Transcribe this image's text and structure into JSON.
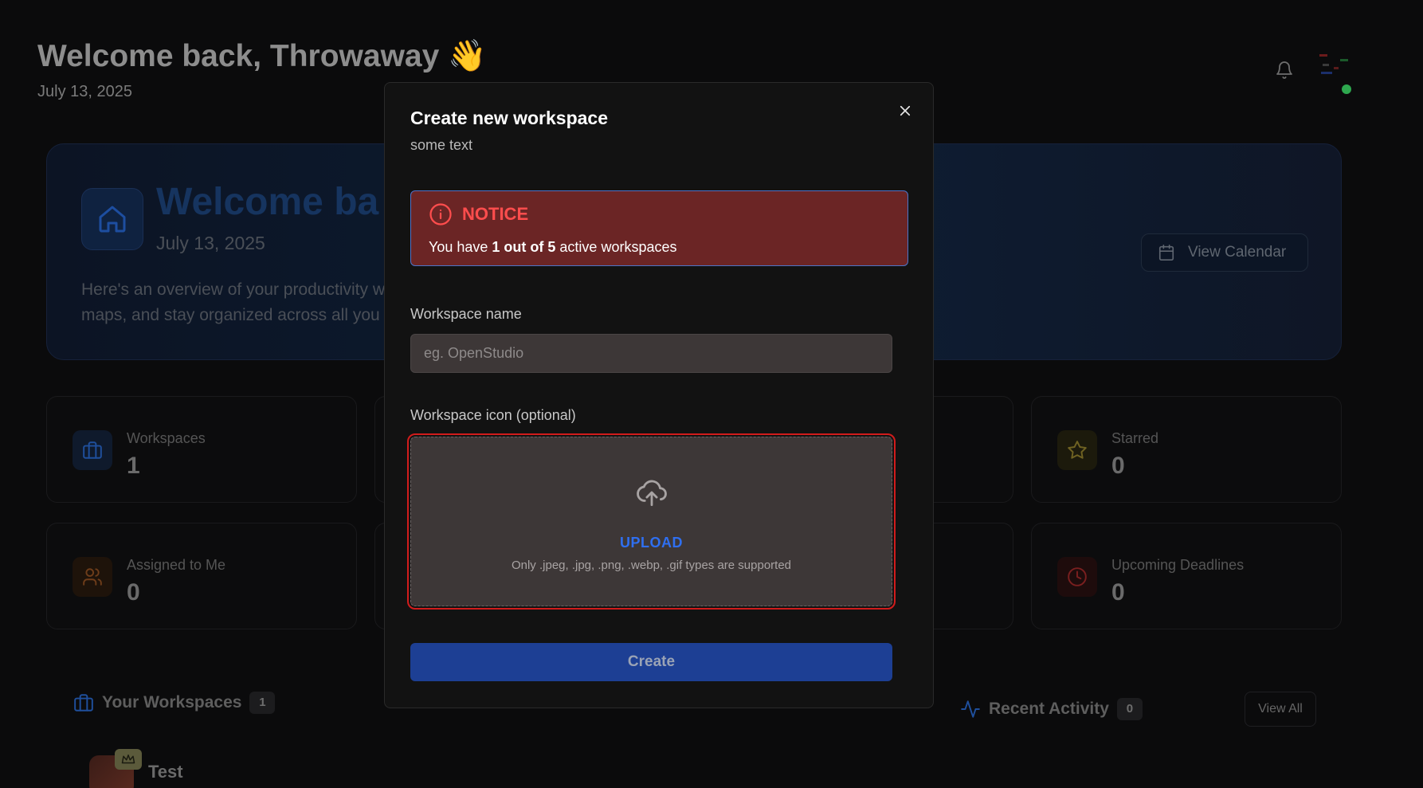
{
  "background": {
    "greeting_title": "Welcome back, Throwaway 👋",
    "greeting_date": "July 13, 2025",
    "hero": {
      "title": "Welcome ba",
      "date": "July 13, 2025",
      "description_line1": "Here's an overview of your productivity w",
      "description_line2": "maps, and stay organized across all you",
      "view_calendar_label": "View Calendar"
    },
    "stats": [
      {
        "label": "Workspaces",
        "value": "1",
        "icon": "briefcase-icon"
      },
      {
        "label": "Starred",
        "value": "0",
        "icon": "star-icon"
      },
      {
        "label": "Assigned to Me",
        "value": "0",
        "icon": "users-icon"
      },
      {
        "label": "Upcoming Deadlines",
        "value": "0",
        "icon": "clock-icon"
      }
    ],
    "your_workspaces": {
      "title": "Your Workspaces",
      "count": "1"
    },
    "recent_activity": {
      "title": "Recent Activity",
      "count": "0",
      "view_all_label": "View All"
    },
    "workspace_item": {
      "name": "Test"
    }
  },
  "modal": {
    "title": "Create new workspace",
    "subtitle": "some text",
    "notice": {
      "heading": "NOTICE",
      "text_prefix": "You have ",
      "text_bold": "1 out of 5",
      "text_suffix": " active workspaces"
    },
    "workspace_name": {
      "label": "Workspace name",
      "placeholder": "eg. OpenStudio",
      "value": ""
    },
    "workspace_icon": {
      "label": "Workspace icon (optional)",
      "upload_label": "UPLOAD",
      "hint": "Only .jpeg, .jpg, .png, .webp, .gif types are supported"
    },
    "create_label": "Create"
  },
  "colors": {
    "modal_bg": "#121212",
    "notice_bg": "#6b2525",
    "notice_heading": "#ff4d4d",
    "upload_accent": "#2f6ff0",
    "upload_outline": "#d11c1c",
    "create_button": "#1d3f94"
  }
}
